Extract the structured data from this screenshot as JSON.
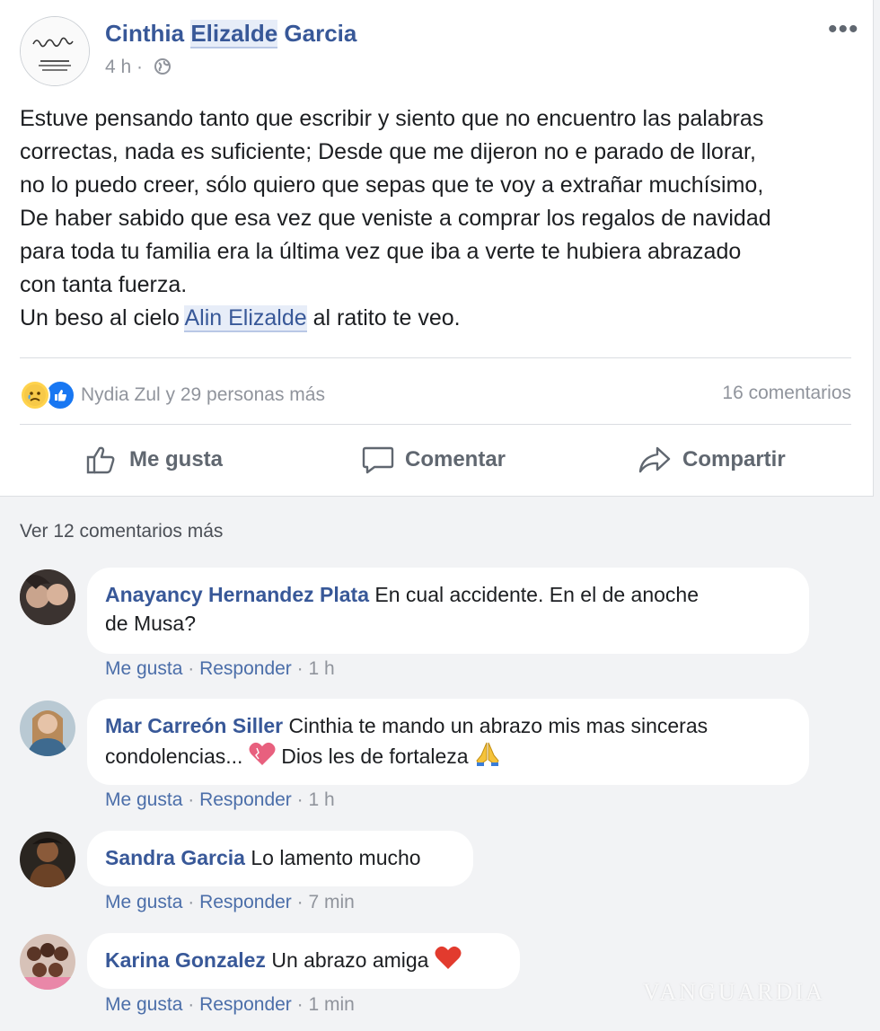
{
  "post": {
    "author_first": "Cinthia",
    "author_middle": "Elizalde",
    "author_last": "Garcia",
    "time": "4 h",
    "separator": "·",
    "more": "•••",
    "body_lines": [
      "Estuve pensando tanto que escribir y siento que no encuentro las palabras",
      "correctas, nada es suficiente; Desde que me dijeron no e parado de llorar,",
      "no lo puedo creer, sólo quiero que sepas que te voy a extrañar muchísimo,",
      "De haber sabido que esa vez que veniste a comprar los regalos de navidad",
      "para toda tu familia era la última vez que iba a verte te hubiera abrazado",
      "con tanta fuerza."
    ],
    "last_line_before": "Un beso al cielo",
    "last_line_mention": "Alin Elizalde",
    "last_line_after": "al ratito te veo.",
    "reactions_text": "Nydia Zul y 29 personas más",
    "comment_count": "16 comentarios",
    "actions": {
      "like": "Me gusta",
      "comment": "Comentar",
      "share": "Compartir"
    }
  },
  "view_more": "Ver 12 comentarios más",
  "comments": [
    {
      "name": "Anayancy Hernandez Plata",
      "text_1": "En cual accidente. En el de anoche",
      "text_2": "de Musa?",
      "like": "Me gusta",
      "reply": "Responder",
      "time": "1 h"
    },
    {
      "name": "Mar Carreón Siller",
      "text_1": "Cinthia te mando un abrazo mis mas sinceras",
      "text_2a": "condolencias...",
      "text_2b": "Dios les de fortaleza",
      "like": "Me gusta",
      "reply": "Responder",
      "time": "1 h"
    },
    {
      "name": "Sandra Garcia",
      "text_1": "Lo lamento mucho",
      "like": "Me gusta",
      "reply": "Responder",
      "time": "7 min"
    },
    {
      "name": "Karina Gonzalez",
      "text_1": "Un abrazo amiga",
      "like": "Me gusta",
      "reply": "Responder",
      "time": "1 min"
    }
  ],
  "watermark": "VANGUARDIA",
  "colors": {
    "link": "#385898",
    "meta": "#90949c",
    "action": "#606770",
    "background": "#f2f3f5"
  }
}
